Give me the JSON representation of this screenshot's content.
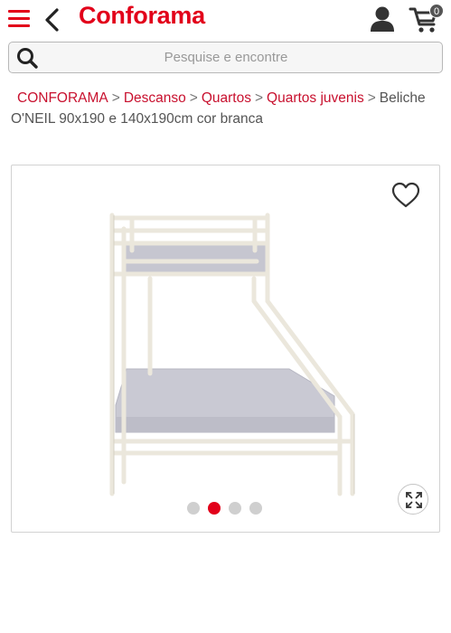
{
  "header": {
    "logo_text": "Conforama",
    "cart_count": "0",
    "icons": {
      "menu": "hamburger-menu-icon",
      "back": "chevron-left-icon",
      "account": "user-icon",
      "cart": "shopping-cart-icon"
    },
    "brand_color": "#e2001a"
  },
  "search": {
    "placeholder": "Pesquise e encontre",
    "icon": "search-icon"
  },
  "breadcrumb": {
    "items": [
      "CONFORAMA",
      "Descanso",
      "Quartos",
      "Quartos juvenis"
    ],
    "separator": ">",
    "current": "Beliche O'NEIL 90x190 e 140x190cm cor branca"
  },
  "gallery": {
    "image_alt": "Beliche O'NEIL 90x190 e 140x190cm cor branca",
    "slide_count": 4,
    "active_slide": 2,
    "icons": {
      "wishlist": "heart-outline-icon",
      "zoom": "expand-arrows-icon"
    },
    "active_dot_color": "#e2001a",
    "inactive_dot_color": "#cfcfcf"
  }
}
